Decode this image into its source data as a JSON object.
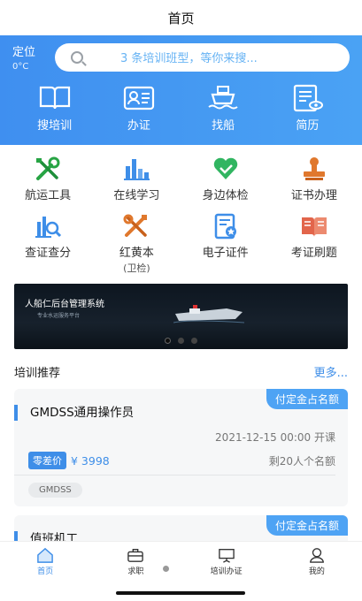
{
  "title": "首页",
  "location": {
    "label": "定位",
    "temperature": "0°C"
  },
  "search": {
    "placeholder": "3 条培训班型，等你来搜..."
  },
  "hero_shortcuts": [
    {
      "label": "搜培训",
      "icon": "book-icon"
    },
    {
      "label": "办证",
      "icon": "id-card-icon"
    },
    {
      "label": "找船",
      "icon": "ship-icon"
    },
    {
      "label": "简历",
      "icon": "resume-icon"
    }
  ],
  "services": [
    {
      "label": "航运工具",
      "sub": "",
      "icon": "tools-icon",
      "color": "#27a444"
    },
    {
      "label": "在线学习",
      "sub": "",
      "icon": "bar-chart-icon",
      "color": "#3e8ee8"
    },
    {
      "label": "身边体检",
      "sub": "",
      "icon": "heart-check-icon",
      "color": "#31b561"
    },
    {
      "label": "证书办理",
      "sub": "",
      "icon": "stamp-icon",
      "color": "#e0782d"
    },
    {
      "label": "查证查分",
      "sub": "",
      "icon": "search-chart-icon",
      "color": "#3e8ee8"
    },
    {
      "label": "红黄本",
      "sub": "(卫检)",
      "icon": "tools-cross-icon",
      "color": "#e0782d"
    },
    {
      "label": "电子证件",
      "sub": "",
      "icon": "e-certificate-icon",
      "color": "#3e8ee8"
    },
    {
      "label": "考证刷题",
      "sub": "",
      "icon": "open-book-icon",
      "color": "#e2654b"
    }
  ],
  "banner": {
    "headline": "人船仁后台管理系统",
    "tagline": "专业水运服务平台"
  },
  "section": {
    "title": "培训推荐",
    "more": "更多..."
  },
  "courses": [
    {
      "corner_tag": "付定金占名额",
      "title": "GMDSS通用操作员",
      "date": "2021-12-15 00:00 开课",
      "price_label": "零差价",
      "price": "¥ 3998",
      "remaining": "剩20人个名额",
      "chip": "GMDSS"
    },
    {
      "corner_tag": "付定金占名额",
      "title": "值班机工"
    }
  ],
  "tabbar": [
    {
      "label": "首页",
      "icon": "home-icon",
      "active": true
    },
    {
      "label": "求职",
      "icon": "briefcase-icon",
      "active": false
    },
    {
      "label": "培训办证",
      "icon": "board-icon",
      "active": false
    },
    {
      "label": "我的",
      "icon": "user-icon",
      "active": false
    }
  ],
  "colors": {
    "primary": "#3e8ee8",
    "header_gradient_start": "#3f8ff0",
    "header_gradient_end": "#4aa2f4"
  }
}
